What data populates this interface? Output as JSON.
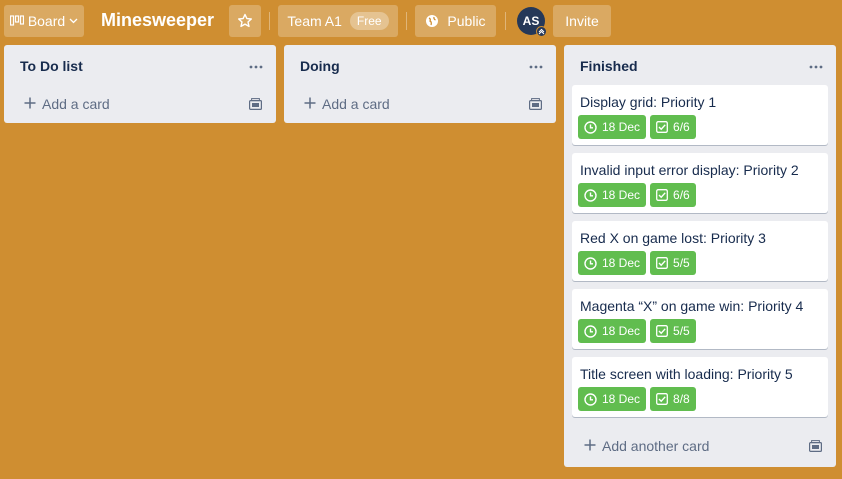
{
  "header": {
    "board_switcher_label": "Board",
    "board_title": "Minesweeper",
    "team_label": "Team A1",
    "team_badge": "Free",
    "visibility_label": "Public",
    "avatar_initials": "AS",
    "invite_label": "Invite"
  },
  "lists": [
    {
      "title": "To Do list",
      "add_card_label": "Add a card",
      "cards": []
    },
    {
      "title": "Doing",
      "add_card_label": "Add a card",
      "cards": []
    },
    {
      "title": "Finished",
      "add_card_label": "Add another card",
      "cards": [
        {
          "title": "Display grid: Priority 1",
          "due": "18 Dec",
          "checklist": "6/6"
        },
        {
          "title": "Invalid input error display: Priority 2",
          "due": "18 Dec",
          "checklist": "6/6"
        },
        {
          "title": "Red X on game lost: Priority 3",
          "due": "18 Dec",
          "checklist": "5/5"
        },
        {
          "title": "Magenta “X” on game win: Priority 4",
          "due": "18 Dec",
          "checklist": "5/5"
        },
        {
          "title": "Title screen with loading: Priority 5",
          "due": "18 Dec",
          "checklist": "8/8"
        }
      ]
    }
  ],
  "colors": {
    "board_background": "#cf8e31",
    "list_background": "#ebecf0",
    "badge_complete": "#61bd4f"
  }
}
